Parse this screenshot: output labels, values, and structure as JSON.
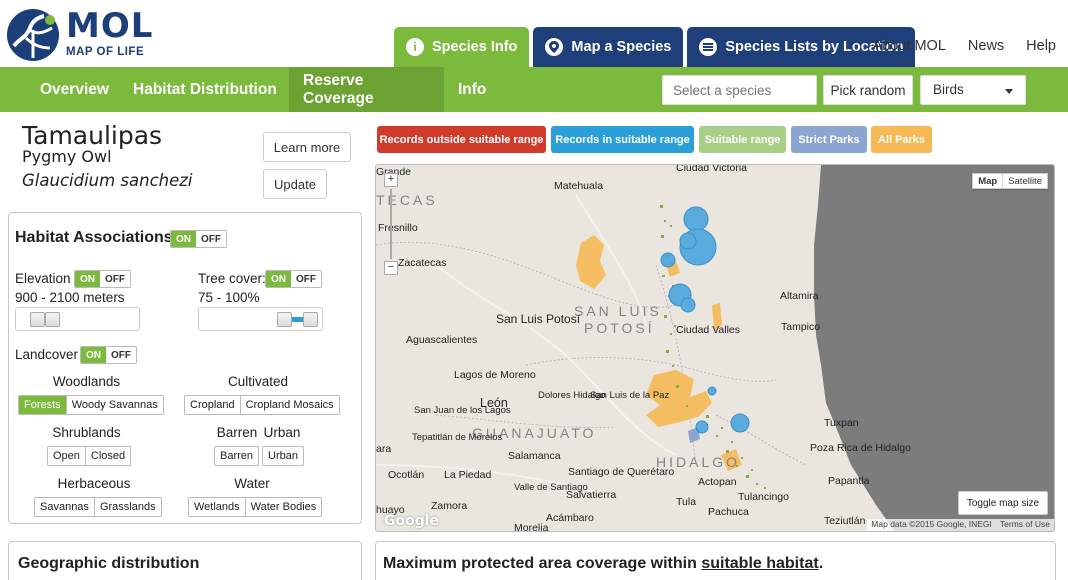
{
  "brand": {
    "logo_text": "MOL",
    "logo_subtitle": "MAP OF LIFE"
  },
  "top_tabs": [
    {
      "label": "Species Info",
      "icon": "info-icon"
    },
    {
      "label": "Map a Species",
      "icon": "map-marker-icon"
    },
    {
      "label": "Species Lists by Location",
      "icon": "list-icon"
    }
  ],
  "top_links": [
    "About MOL",
    "News",
    "Help"
  ],
  "subnav": {
    "items": [
      "Overview",
      "Habitat Distribution",
      "Reserve Coverage",
      "Info"
    ],
    "active": "Reserve Coverage",
    "species_placeholder": "Select a species",
    "pick_random": "Pick random",
    "taxon": "Birds"
  },
  "species": {
    "common_name_line1": "Tamaulipas",
    "common_name_line2": "Pygmy Owl",
    "scientific_name": "Glaucidium sanchezi",
    "learn_more": "Learn more",
    "update": "Update"
  },
  "habitat": {
    "title": "Habitat Associations",
    "on": "ON",
    "off": "OFF",
    "elevation_label": "Elevation",
    "elevation_range": "900 - 2100 meters",
    "tree_cover_label": "Tree cover:",
    "tree_cover_range": "75 - 100%",
    "landcover_label": "Landcover",
    "categories": {
      "woodlands": {
        "title": "Woodlands",
        "options": [
          "Forests",
          "Woody Savannas"
        ]
      },
      "cultivated": {
        "title": "Cultivated",
        "options": [
          "Cropland",
          "Cropland Mosaics"
        ]
      },
      "shrublands": {
        "title": "Shrublands",
        "options": [
          "Open",
          "Closed"
        ]
      },
      "barren": {
        "title": "Barren",
        "options": [
          "Barren"
        ]
      },
      "urban": {
        "title": "Urban",
        "options": [
          "Urban"
        ]
      },
      "herbaceous": {
        "title": "Herbaceous",
        "options": [
          "Savannas",
          "Grasslands"
        ]
      },
      "water": {
        "title": "Water",
        "options": [
          "Wetlands",
          "Water Bodies"
        ]
      }
    },
    "selected_options": [
      "Forests"
    ]
  },
  "legend": [
    {
      "label": "Records outside suitable range",
      "color": "#d03b2c"
    },
    {
      "label": "Records in suitable range",
      "color": "#2a9fd8"
    },
    {
      "label": "Suitable range",
      "color": "#a8cf86"
    },
    {
      "label": "Strict Parks",
      "color": "#8aa6d1"
    },
    {
      "label": "All Parks",
      "color": "#f7b955"
    }
  ],
  "map": {
    "map_type": [
      "Map",
      "Satellite"
    ],
    "toggle_size": "Toggle map size",
    "attribution": "Map data ©2015 Google, INEGI",
    "terms": "Terms of Use",
    "google": "Google",
    "states": [
      "TECAS",
      "SAN LUIS",
      "POTOSÍ",
      "GUANAJUATO",
      "HIDALGO"
    ],
    "places": [
      "Grande",
      "Ciudad Victoria",
      "Matehuala",
      "Fresnillo",
      "Zacatecas",
      "Altamira",
      "San Luis Potosí",
      "Ciudad Valles",
      "Tampico",
      "Aguascalientes",
      "Lagos de Moreno",
      "San Juan de los Lagos",
      "León",
      "Dolores Hidalgo",
      "San Luis de la Paz",
      "Tepatitlán de Morelos",
      "Tuxpan",
      "Salamanca",
      "Poza Rica de Hidalgo",
      "Papantla",
      "Ocotlán",
      "La Piedad",
      "Santiago de Querétaro",
      "Actopan",
      "Valle de Santiago",
      "Salvatierra",
      "Tula",
      "Tulancingo",
      "Zamora",
      "Pachuca",
      "Acámbaro",
      "Morelia",
      "Teziutlán",
      "ara",
      "huayo"
    ]
  },
  "bottom": {
    "geo_title": "Geographic distribution",
    "coverage_prefix": "Maximum protected area coverage within ",
    "coverage_link": "suitable habitat",
    "coverage_suffix": "."
  },
  "colors": {
    "green": "#7cba3d",
    "navy": "#1e3f7a"
  }
}
